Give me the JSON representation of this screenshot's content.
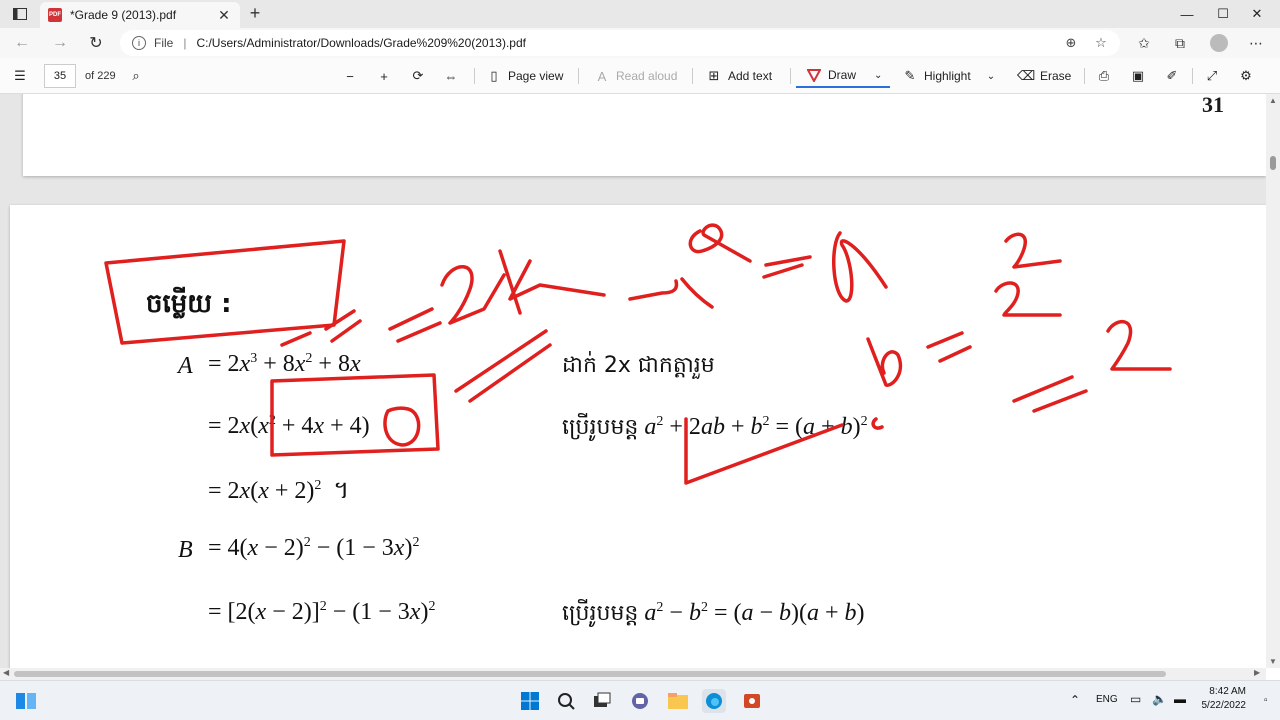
{
  "browser": {
    "tab_title": "*Grade 9 (2013).pdf",
    "tab_close": "✕",
    "new_tab": "+",
    "file_label": "File",
    "url": "C:/Users/Administrator/Downloads/Grade%209%20(2013).pdf",
    "window_controls": {
      "minimize": "—",
      "maximize": "☐",
      "close": "✕"
    }
  },
  "pdf_toolbar": {
    "page_number": "35",
    "page_total": "of 229",
    "page_view": "Page view",
    "read_aloud": "Read aloud",
    "add_text": "Add text",
    "draw": "Draw",
    "highlight": "Highlight",
    "erase": "Erase",
    "draw_color": "#d13438"
  },
  "document": {
    "printed_page_number": "31",
    "heading": "ចម្លើយ :",
    "line_A1": {
      "left": "A",
      "rhs": "= 2x³ + 8x² + 8x"
    },
    "line_A2": "= 2x(x² + 4x + 4)",
    "line_A3": "= 2x(x + 2)²  ។",
    "line_B1": {
      "left": "B",
      "rhs": "= 4(x − 2)² − (1 − 3x)²"
    },
    "line_B2": "= [2(x − 2)]² − (1 − 3x)²",
    "note_1": "ដាក់ 2x ជាកត្តារួម",
    "note_2_kh": "ប្រើរូបមន្ត",
    "note_2_formula": "a² + 2ab + b² = (a + b)²",
    "note_3_kh": "ប្រើរូបមន្ត",
    "note_3_formula": "a² − b² = (a − b)(a + b)",
    "ink_color": "#e0201e"
  },
  "taskbar": {
    "language": "ENG",
    "time": "8:42 AM",
    "date": "5/22/2022"
  }
}
